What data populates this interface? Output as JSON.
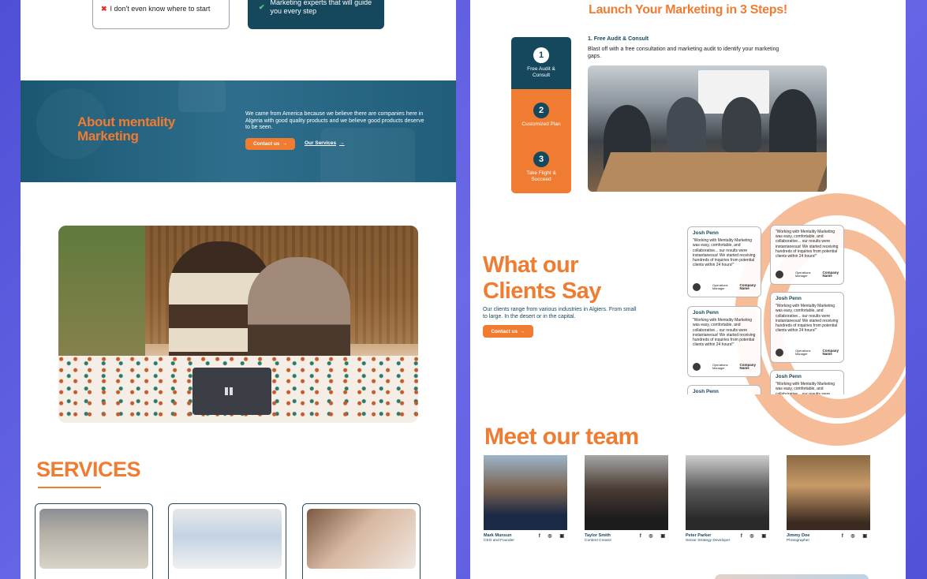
{
  "left": {
    "top_card_a": "I don't even know where to start",
    "top_card_b": "Marketing experts that will guide you every step",
    "about": {
      "title": "About mentality Marketing",
      "text": "We came from America because we believe there are companies here in Algeria with good quality products and we believe good products  deserve to be seen.",
      "contact_label": "Contact us",
      "services_label": "Our Services"
    },
    "services_title": "SERVICES"
  },
  "right": {
    "launch_title": "Launch Your Marketing in 3 Steps!",
    "steps": [
      {
        "num": "1",
        "label": "Free Audit & Consult"
      },
      {
        "num": "2",
        "label": "Customized Plan"
      },
      {
        "num": "3",
        "label": "Take Flight & Succeed"
      }
    ],
    "step_head": "1. Free Audit & Consult",
    "step_desc": "Blast off with a free consultation and marketing audit to identify your marketing gaps.",
    "clients": {
      "title_line1": "What our",
      "title_line2": "Clients Say",
      "text": "Our clients range from various industries in Algiers. From small to large. In the desert or in the capital.",
      "contact_label": "Contact us"
    },
    "testimonial": {
      "name": "Josh Penn",
      "quote": "\"Working with Mentality Marketing was easy, comfortable, and collaborative... our results were instantaneous! We started receiving hundreds of inquiries from potential clients within 24 hours!\"",
      "role_line1": "Operations",
      "role_line2": "Manager",
      "company_line1": "Company",
      "company_line2": "Name"
    },
    "team_title": "Meet our team",
    "team": [
      {
        "name": "Mark Munsun",
        "role": "CEO and Founder"
      },
      {
        "name": "Taylor Smith",
        "role": "Content Creator"
      },
      {
        "name": "Peter Parker",
        "role": "Senior Strategy Developer"
      },
      {
        "name": "Jimmy Doe",
        "role": "Photographer"
      }
    ],
    "social_icons": "f ◎ ▣"
  },
  "colors": {
    "accent": "#f07c32",
    "dark": "#15485d",
    "background": "#5b5bdc"
  }
}
